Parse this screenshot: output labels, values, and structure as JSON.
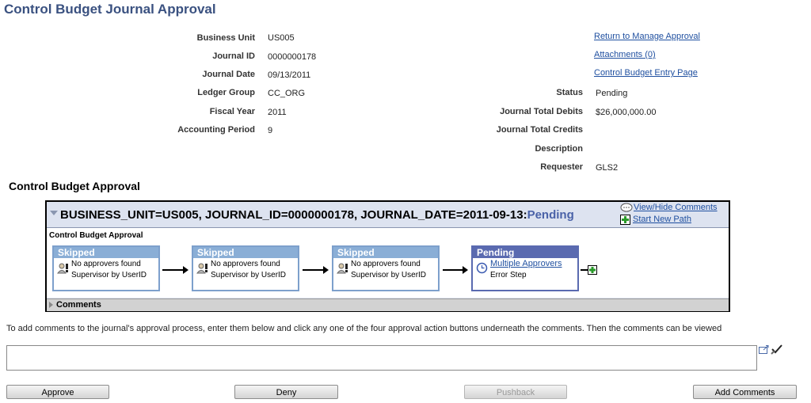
{
  "page_title": "Control Budget Journal Approval",
  "fields": {
    "business_unit": {
      "label": "Business Unit",
      "value": "US005"
    },
    "journal_id": {
      "label": "Journal ID",
      "value": "0000000178"
    },
    "journal_date": {
      "label": "Journal Date",
      "value": "09/13/2011"
    },
    "ledger_group": {
      "label": "Ledger Group",
      "value": "CC_ORG"
    },
    "fiscal_year": {
      "label": "Fiscal Year",
      "value": "2011"
    },
    "accounting_period": {
      "label": "Accounting Period",
      "value": "9"
    },
    "status": {
      "label": "Status",
      "value": "Pending"
    },
    "total_debits": {
      "label": "Journal Total Debits",
      "value": "$26,000,000.00"
    },
    "total_credits": {
      "label": "Journal Total Credits",
      "value": ""
    },
    "description": {
      "label": "Description",
      "value": ""
    },
    "requester": {
      "label": "Requester",
      "value": "GLS2"
    }
  },
  "links": {
    "return": "Return to Manage Approval",
    "attachments": "Attachments (0)",
    "entry_page": "Control Budget Entry Page"
  },
  "approval_section_title": "Control Budget Approval",
  "approval_box": {
    "header_text": "BUSINESS_UNIT=US005, JOURNAL_ID=0000000178, JOURNAL_DATE=2011-09-13:",
    "header_status": "Pending",
    "view_hide_comments": "View/Hide Comments",
    "start_new_path": "Start New Path",
    "inner_title": "Control Budget Approval",
    "steps": [
      {
        "status": "Skipped",
        "line1": "No approvers found",
        "line2": "Supervisor by UserID"
      },
      {
        "status": "Skipped",
        "line1": "No approvers found",
        "line2": "Supervisor by UserID"
      },
      {
        "status": "Skipped",
        "line1": "No approvers found",
        "line2": "Supervisor by UserID"
      },
      {
        "status": "Pending",
        "line1": "Multiple Approvers",
        "line2": "Error Step"
      }
    ],
    "comments_label": "Comments"
  },
  "instructions": "To add comments to the journal's approval process, enter them below and click any one of the four approval action buttons underneath the comments. Then the comments can be viewed",
  "comment_input": {
    "value": "",
    "placeholder": ""
  },
  "buttons": {
    "approve": "Approve",
    "deny": "Deny",
    "pushback": "Pushback",
    "add_comments": "Add Comments"
  },
  "icons": [
    "speech-bubble-icon",
    "add-path-icon",
    "user-warning-icon",
    "clock-icon",
    "add-step-icon",
    "expand-textarea-icon",
    "spell-check-icon"
  ]
}
